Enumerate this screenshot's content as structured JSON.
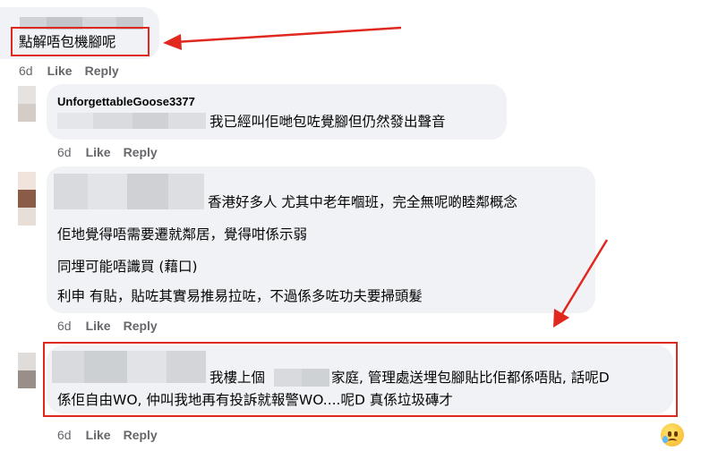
{
  "comments": [
    {
      "author": "",
      "lines": [
        "點解唔包機腳呢"
      ],
      "age": "6d",
      "like": "Like",
      "reply": "Reply"
    },
    {
      "author": "UnforgettableGoose3377",
      "lines": [
        "我已經叫佢哋包咗覺腳但仍然發出聲音"
      ],
      "age": "6d",
      "like": "Like",
      "reply": "Reply"
    },
    {
      "author": "",
      "lines": [
        "香港好多人 尤其中老年嗰班，完全無呢啲睦鄰概念",
        "佢地覺得唔需要遷就鄰居，覺得咁係示弱",
        "同埋可能唔識買 (藉口)",
        "利申 有貼，貼咗其實易推易拉咗，不過係多咗功夫要掃頭髮"
      ],
      "age": "6d",
      "like": "Like",
      "reply": "Reply"
    },
    {
      "author": "",
      "lines_a": [
        "我樓上個",
        "家庭, 管理處送埋包腳貼比佢都係唔貼, 話呢D"
      ],
      "lines": [
        "係佢自由WO, 仲叫我地再有投訴就報警WO....呢D 真係垃圾磚才"
      ],
      "age": "6d",
      "like": "Like",
      "reply": "Reply"
    }
  ],
  "colors": {
    "highlight": "#e0281f",
    "bubble": "#f0f2f5",
    "meta": "#65676b"
  },
  "icons": [
    "sad-tear-emoji-icon"
  ]
}
